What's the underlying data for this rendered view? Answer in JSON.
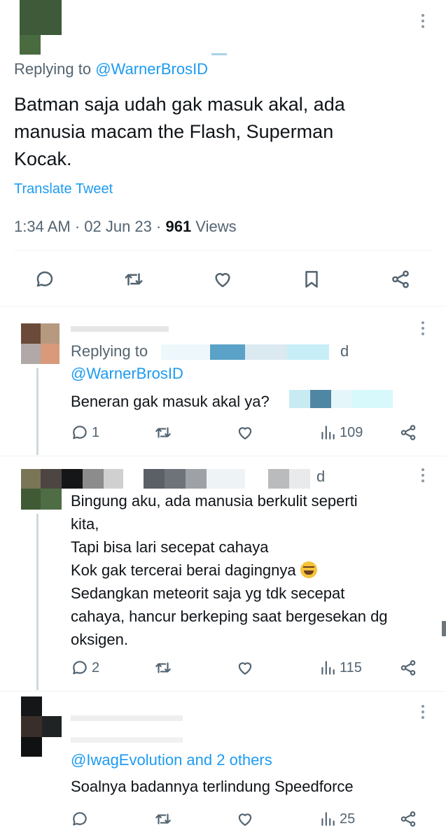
{
  "main_tweet": {
    "replying_prefix": "Replying to ",
    "replying_handle": "@WarnerBrosID",
    "text": "Batman saja udah gak masuk akal, ada\nmanusia macam the Flash, Superman\nKocak.",
    "translate_label": "Translate Tweet",
    "time": "1:34 AM · 02 Jun 23 · ",
    "views_count": "961",
    "views_label": " Views",
    "actions": [
      "reply-icon",
      "retweet-icon",
      "like-icon",
      "bookmark-icon",
      "share-icon"
    ]
  },
  "replies": [
    {
      "replying_prefix": "Replying to",
      "trailing_char": "d",
      "replying_handle": "@WarnerBrosID",
      "text": "Beneran gak masuk akal ya?",
      "reply_count": "1",
      "retweet_count": "",
      "like_count": "",
      "views": "109"
    },
    {
      "trailing_char": "d",
      "text": "Bingung aku, ada manusia berkulit seperti\nkita,\nTapi bisa lari secepat cahaya\nKok gak tercerai berai dagingnya",
      "text_after_emoji": "\nSedangkan meteorit saja yg tdk secepat\ncahaya, hancur berkeping saat bergesekan dg\noksigen.",
      "emoji": "rolling-on-floor-laughing-emoji",
      "reply_count": "2",
      "views": "115"
    },
    {
      "replying_handle": "@IwagEvolution and 2 others",
      "text": "Soalnya badannya terlindung Speedforce",
      "reply_count": "",
      "views": "25"
    }
  ],
  "colors": {
    "link": "#1d9bf0",
    "secondary_text": "#536471",
    "primary_text": "#0f1419",
    "divider": "#eff3f4",
    "thread_line": "#cfd9de"
  }
}
